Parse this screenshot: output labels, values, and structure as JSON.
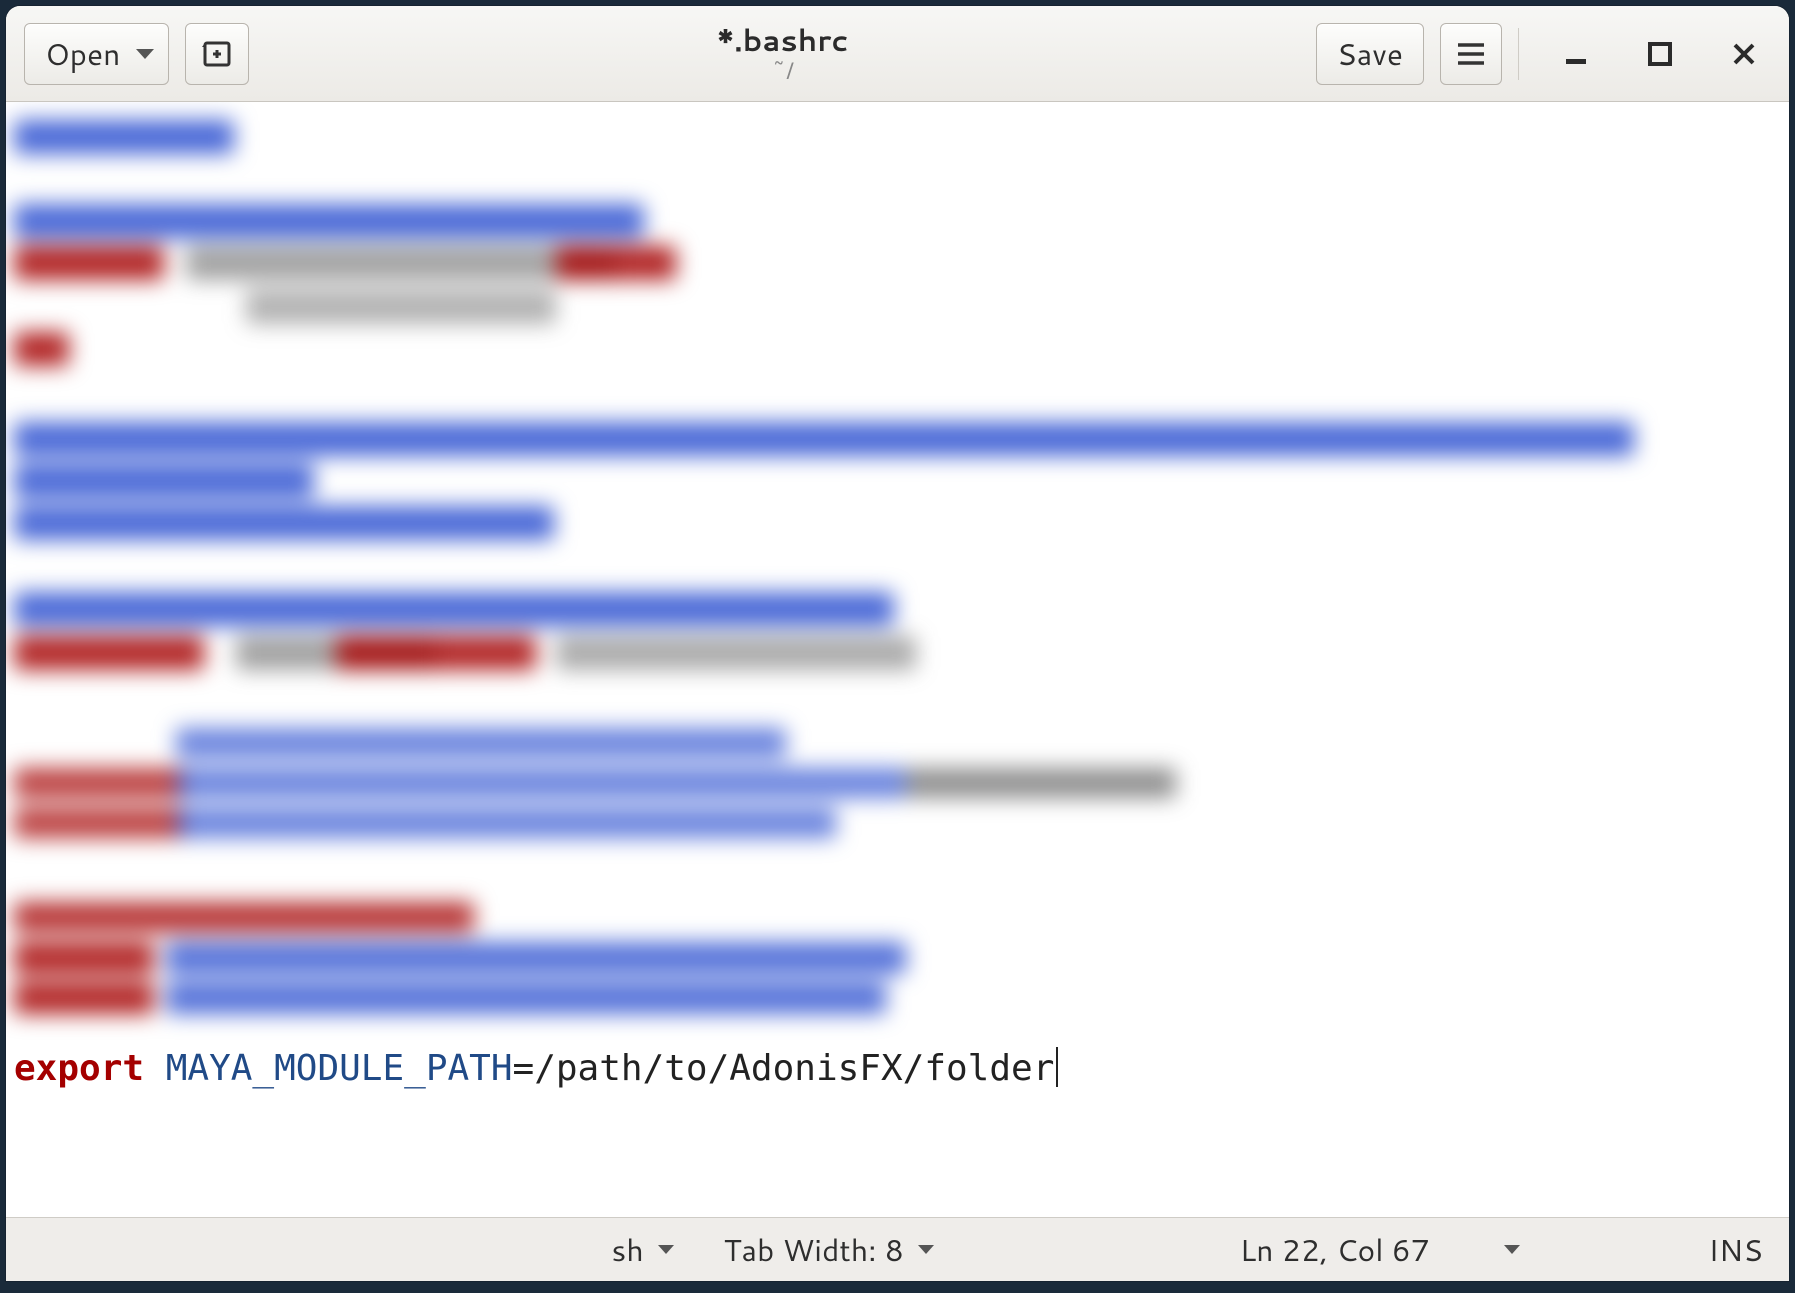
{
  "header": {
    "open_label": "Open",
    "save_label": "Save",
    "title": "*.bashrc",
    "subtitle": "~/"
  },
  "editor": {
    "keyword": "export",
    "variable": "MAYA_MODULE_PATH",
    "assignment": "=/path/to/AdonisFX/folder"
  },
  "statusbar": {
    "syntax_mode": "sh",
    "tab_width_label": "Tab Width: 8",
    "cursor_pos": "Ln 22, Col 67",
    "insert_mode": "INS"
  }
}
